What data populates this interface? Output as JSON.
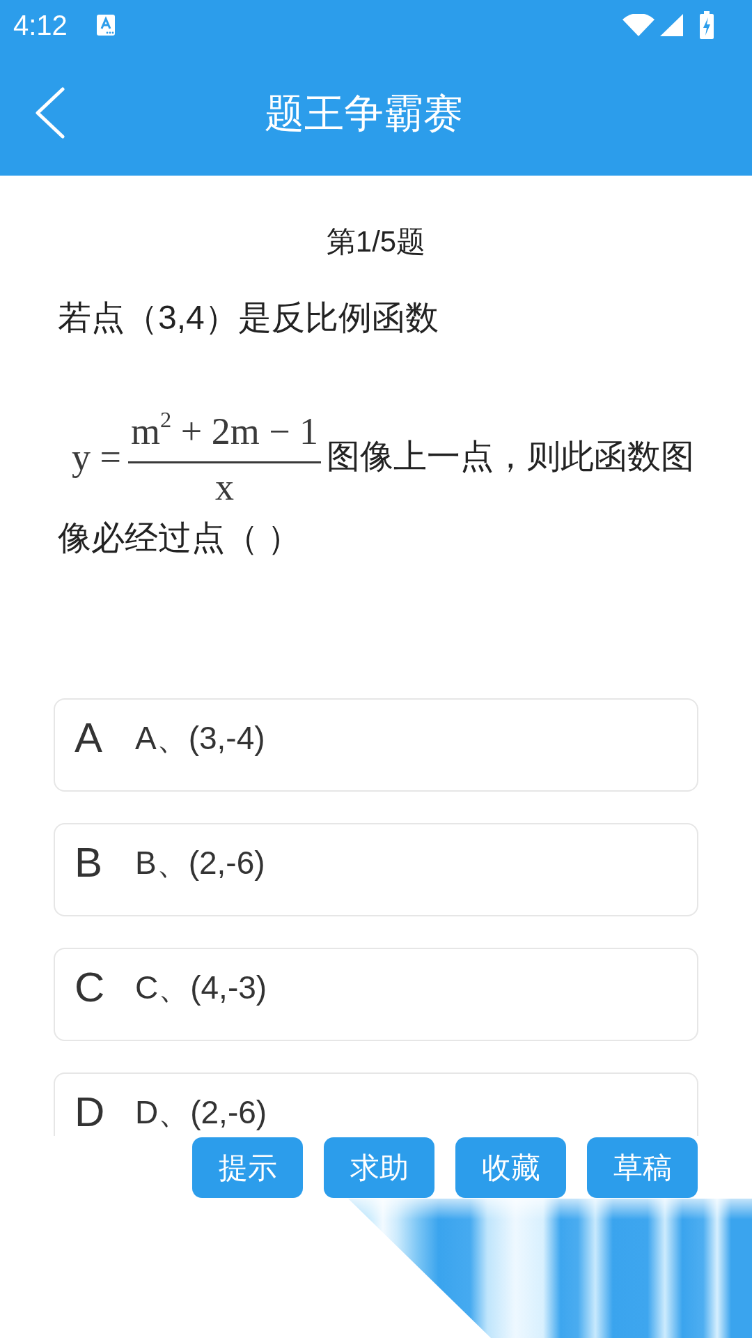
{
  "status_bar": {
    "time": "4:12"
  },
  "toolbar": {
    "title": "题王争霸赛"
  },
  "question": {
    "counter": "第1/5题",
    "lead_text": "若点（3,4）是反比例函数",
    "formula": {
      "lhs": "y =",
      "numerator": "m$^{2}$ + 2m − 1",
      "denominator": "x"
    },
    "text_lines": [
      "图像上一点，则此函数图",
      "像必经过点（ ）"
    ]
  },
  "options": [
    {
      "letter": "A",
      "text": "A、(3,-4)"
    },
    {
      "letter": "B",
      "text": "B、(2,-6)"
    },
    {
      "letter": "C",
      "text": "C、(4,-3)"
    },
    {
      "letter": "D",
      "text": "D、(2,-6)"
    }
  ],
  "buttons": [
    {
      "label": "提示"
    },
    {
      "label": "求助"
    },
    {
      "label": "收藏"
    },
    {
      "label": "草稿"
    }
  ]
}
